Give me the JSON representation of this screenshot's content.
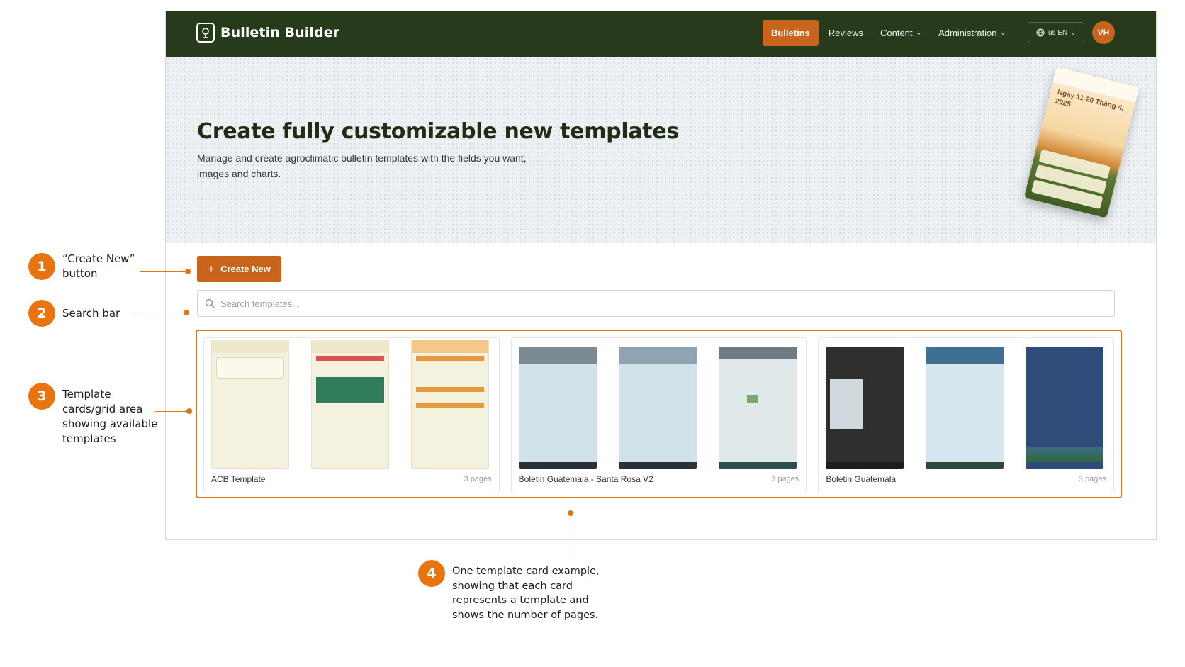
{
  "app": {
    "brand": "Bulletin Builder",
    "nav": [
      {
        "label": "Bulletins",
        "active": true
      },
      {
        "label": "Reviews",
        "active": false
      },
      {
        "label": "Content",
        "active": false,
        "dropdown": true
      },
      {
        "label": "Administration",
        "active": false,
        "dropdown": true
      }
    ],
    "language": "us EN",
    "avatar_initials": "VH",
    "colors": {
      "topbar": "#283a1c",
      "accent": "#c8641b"
    }
  },
  "hero": {
    "title": "Create fully customizable new templates",
    "subtitle": "Manage and create agroclimatic bulletin templates with the fields you want, images and charts.",
    "poster_text": "Ngày 11-20 Tháng 4, 2025"
  },
  "actions": {
    "create_label": "Create New",
    "search_placeholder": "Search templates..."
  },
  "templates": [
    {
      "name": "ACB Template",
      "pages": "3 pages",
      "style": "cream"
    },
    {
      "name": "Boletin Guatemala - Santa Rosa V2",
      "pages": "3 pages",
      "style": "light"
    },
    {
      "name": "Boletin Guatemala",
      "pages": "3 pages",
      "style": "dark"
    }
  ],
  "annotations": [
    {
      "number": "1",
      "text": "“Create New” button"
    },
    {
      "number": "2",
      "text": "Search bar"
    },
    {
      "number": "3",
      "text": "Template cards/grid area showing available templates"
    },
    {
      "number": "4",
      "text": "One template card example, showing that each card represents a template and shows the number of pages."
    }
  ]
}
